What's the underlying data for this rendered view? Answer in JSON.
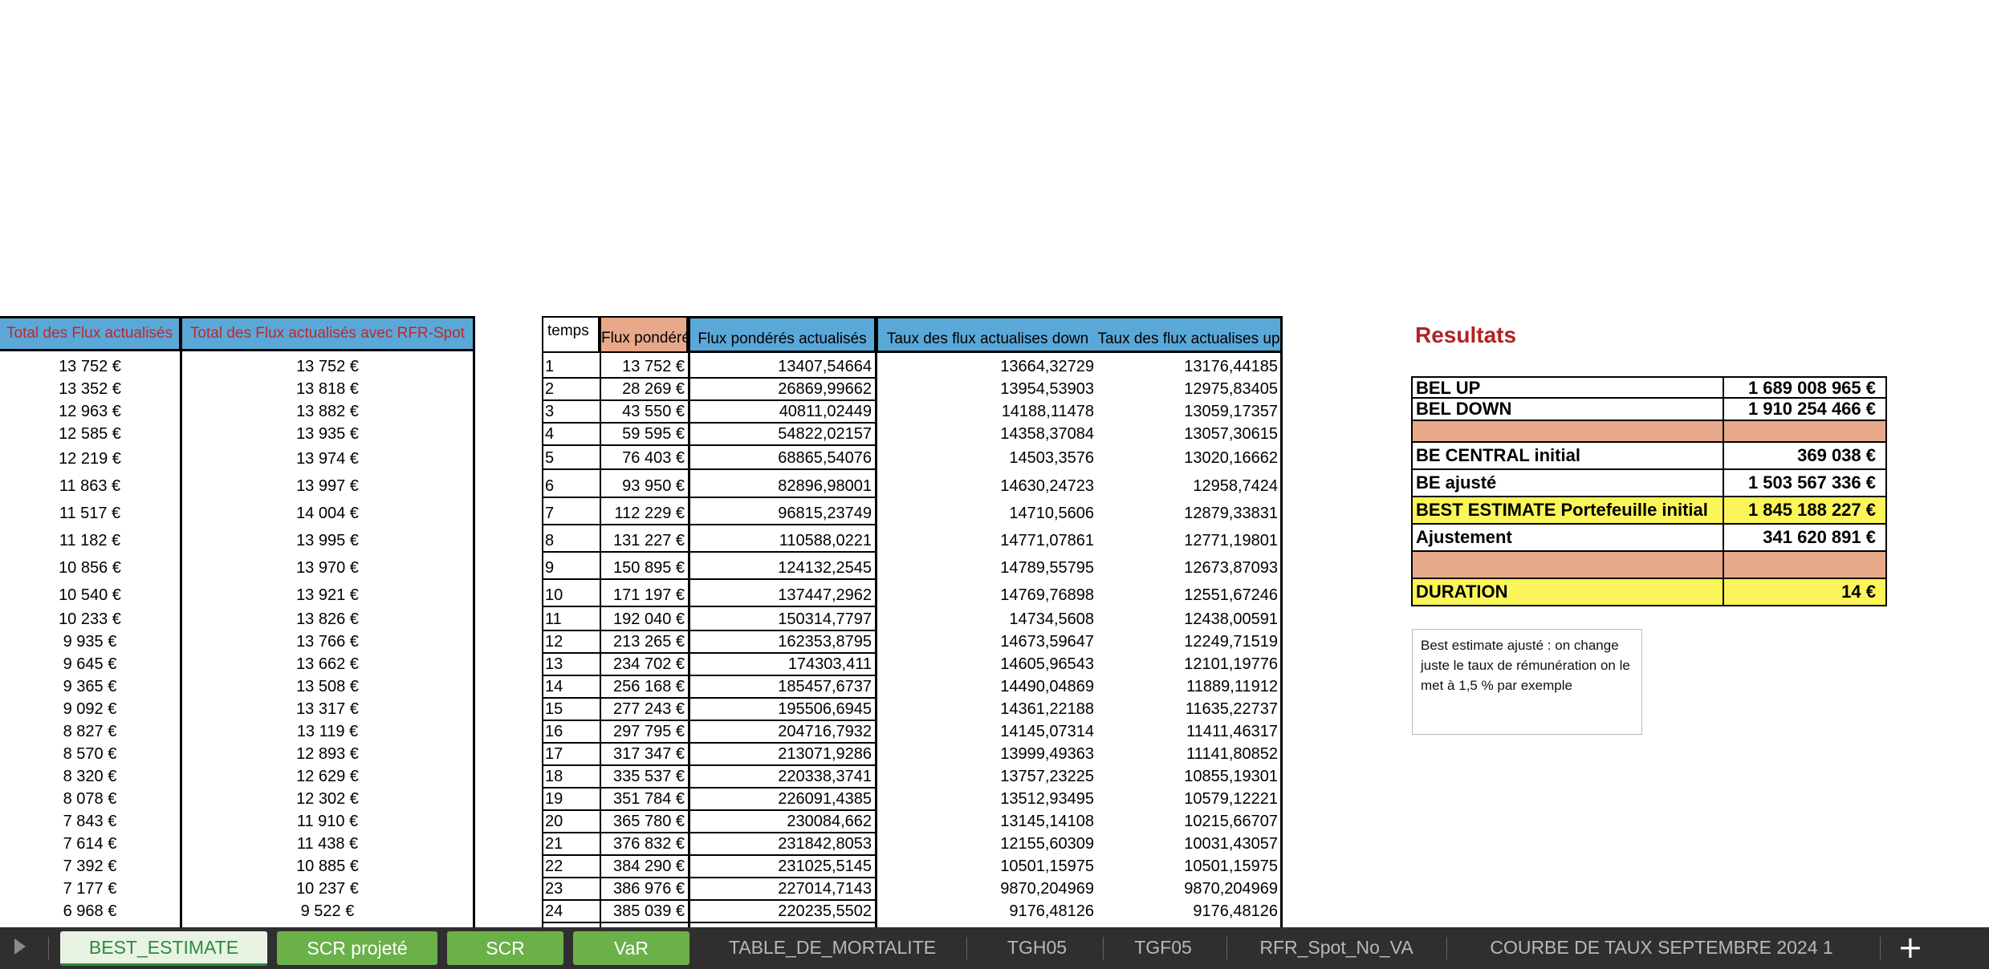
{
  "left_table": {
    "headers": [
      "Total des Flux actualisés",
      "Total des Flux actualisés avec RFR-Spot"
    ],
    "rows": [
      [
        "13 752 €",
        "13 752 €"
      ],
      [
        "13 352 €",
        "13 818 €"
      ],
      [
        "12 963 €",
        "13 882 €"
      ],
      [
        "12 585 €",
        "13 935 €"
      ],
      [
        "12 219 €",
        "13 974 €"
      ],
      [
        "11 863 €",
        "13 997 €"
      ],
      [
        "11 517 €",
        "14 004 €"
      ],
      [
        "11 182 €",
        "13 995 €"
      ],
      [
        "10 856 €",
        "13 970 €"
      ],
      [
        "10 540 €",
        "13 921 €"
      ],
      [
        "10 233 €",
        "13 826 €"
      ],
      [
        "9 935 €",
        "13 766 €"
      ],
      [
        "9 645 €",
        "13 662 €"
      ],
      [
        "9 365 €",
        "13 508 €"
      ],
      [
        "9 092 €",
        "13 317 €"
      ],
      [
        "8 827 €",
        "13 119 €"
      ],
      [
        "8 570 €",
        "12 893 €"
      ],
      [
        "8 320 €",
        "12 629 €"
      ],
      [
        "8 078 €",
        "12 302 €"
      ],
      [
        "7 843 €",
        "11 910 €"
      ],
      [
        "7 614 €",
        "11 438 €"
      ],
      [
        "7 392 €",
        "10 885 €"
      ],
      [
        "7 177 €",
        "10 237 €"
      ],
      [
        "6 968 €",
        "9 522 €"
      ]
    ]
  },
  "mid_table": {
    "headers": [
      "temps",
      "Flux pondérés",
      "Flux pondérés actualisés",
      "Taux des flux actualises down",
      "Taux des flux actualises up"
    ],
    "rows": [
      [
        "1",
        "13 752 €",
        "13407,54664",
        "13664,32729",
        "13176,44185"
      ],
      [
        "2",
        "28 269 €",
        "26869,99662",
        "13954,53903",
        "12975,83405"
      ],
      [
        "3",
        "43 550 €",
        "40811,02449",
        "14188,11478",
        "13059,17357"
      ],
      [
        "4",
        "59 595 €",
        "54822,02157",
        "14358,37084",
        "13057,30615"
      ],
      [
        "5",
        "76 403 €",
        "68865,54076",
        "14503,3576",
        "13020,16662"
      ],
      [
        "6",
        "93 950 €",
        "82896,98001",
        "14630,24723",
        "12958,7424"
      ],
      [
        "7",
        "112 229 €",
        "96815,23749",
        "14710,5606",
        "12879,33831"
      ],
      [
        "8",
        "131 227 €",
        "110588,0221",
        "14771,07861",
        "12771,19801"
      ],
      [
        "9",
        "150 895 €",
        "124132,2545",
        "14789,55795",
        "12673,87093"
      ],
      [
        "10",
        "171 197 €",
        "137447,2962",
        "14769,76898",
        "12551,67246"
      ],
      [
        "11",
        "192 040 €",
        "150314,7797",
        "14734,5608",
        "12438,00591"
      ],
      [
        "12",
        "213 265 €",
        "162353,8795",
        "14673,59647",
        "12249,71519"
      ],
      [
        "13",
        "234 702 €",
        "174303,411",
        "14605,96543",
        "12101,19776"
      ],
      [
        "14",
        "256 168 €",
        "185457,6737",
        "14490,04869",
        "11889,11912"
      ],
      [
        "15",
        "277 243 €",
        "195506,6945",
        "14361,22188",
        "11635,22737"
      ],
      [
        "16",
        "297 795 €",
        "204716,7932",
        "14145,07314",
        "11411,46317"
      ],
      [
        "17",
        "317 347 €",
        "213071,9286",
        "13999,49363",
        "11141,80852"
      ],
      [
        "18",
        "335 537 €",
        "220338,3741",
        "13757,23225",
        "10855,19301"
      ],
      [
        "19",
        "351 784 €",
        "226091,4385",
        "13512,93495",
        "10579,12221"
      ],
      [
        "20",
        "365 780 €",
        "230084,662",
        "13145,14108",
        "10215,66707"
      ],
      [
        "21",
        "376 832 €",
        "231842,8053",
        "12155,60309",
        "10031,43057"
      ],
      [
        "22",
        "384 290 €",
        "231025,5145",
        "10501,15975",
        "10501,15975"
      ],
      [
        "23",
        "386 976 €",
        "227014,7143",
        "9870,204969",
        "9870,204969"
      ],
      [
        "24",
        "385 039 €",
        "220235,5502",
        "9176,48126",
        "9176,48126"
      ]
    ]
  },
  "results": {
    "title": "Resultats",
    "rows": [
      {
        "label": "BEL UP",
        "value": "1 689 008 965 €",
        "bg": "#ffffff"
      },
      {
        "label": "BEL DOWN",
        "value": "1 910 254 466 €",
        "bg": "#ffffff"
      },
      {
        "label": "",
        "value": "",
        "bg": "#e8a98a"
      },
      {
        "label": "BE CENTRAL initial",
        "value": "369 038 €",
        "bg": "#ffffff"
      },
      {
        "label": "BE ajusté",
        "value": "1 503 567 336 €",
        "bg": "#ffffff"
      },
      {
        "label": "BEST ESTIMATE Portefeuille initial",
        "value": "1 845 188 227 €",
        "bg": "#fbf55a"
      },
      {
        "label": "Ajustement",
        "value": "341 620 891 €",
        "bg": "#ffffff"
      },
      {
        "label": "",
        "value": "",
        "bg": "#e8a98a"
      },
      {
        "label": "DURATION",
        "value": "14 €",
        "bg": "#fbf55a"
      }
    ],
    "note": "Best estimate ajusté : on change juste le taux de rémunération on le met à 1,5 % par exemple"
  },
  "tabs": [
    {
      "label": "BEST_ESTIMATE",
      "style": "active"
    },
    {
      "label": "SCR projeté",
      "style": "green"
    },
    {
      "label": "SCR",
      "style": "green"
    },
    {
      "label": "VaR",
      "style": "green"
    },
    {
      "label": "TABLE_DE_MORTALITE",
      "style": "gray"
    },
    {
      "label": "TGH05",
      "style": "gray"
    },
    {
      "label": "TGF05",
      "style": "gray"
    },
    {
      "label": "RFR_Spot_No_VA",
      "style": "gray"
    },
    {
      "label": "COURBE DE TAUX SEPTEMBRE 2024 1",
      "style": "gray"
    }
  ],
  "colors": {
    "header_blue": "#5aa8d8",
    "header_orange": "#e8a98a",
    "highlight_yellow": "#fbf55a",
    "tab_green": "#6bb14a",
    "results_title": "#b22222"
  },
  "icons": [
    "play-icon",
    "plus-icon"
  ]
}
